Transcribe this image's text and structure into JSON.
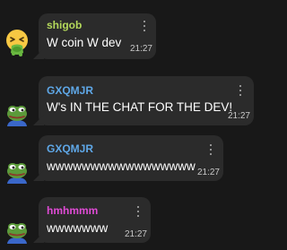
{
  "colors": {
    "background": "#181818",
    "bubble": "#2b2b2b",
    "name_green": "#b4d95b",
    "name_blue": "#5fa8e8",
    "name_magenta": "#e04bd6"
  },
  "messages": [
    {
      "author": "shigob",
      "text": "W coin W dev",
      "time": "21:27",
      "avatar_icon": "nauseated-face-emoji",
      "name_color": "#b4d95b"
    },
    {
      "author": "GXQMJR",
      "text": "W's IN THE CHAT FOR THE DEV!",
      "time": "21:27",
      "avatar_icon": "pepe-frog-avatar",
      "name_color": "#5fa8e8"
    },
    {
      "author": "GXQMJR",
      "text": "wwwwwwwwwwwwwwwww",
      "time": "21:27",
      "avatar_icon": "pepe-frog-avatar",
      "name_color": "#5fa8e8"
    },
    {
      "author": "hmhmmm",
      "text": "wwwwwww",
      "time": "21:27",
      "avatar_icon": "pepe-frog-avatar",
      "name_color": "#e04bd6"
    }
  ]
}
